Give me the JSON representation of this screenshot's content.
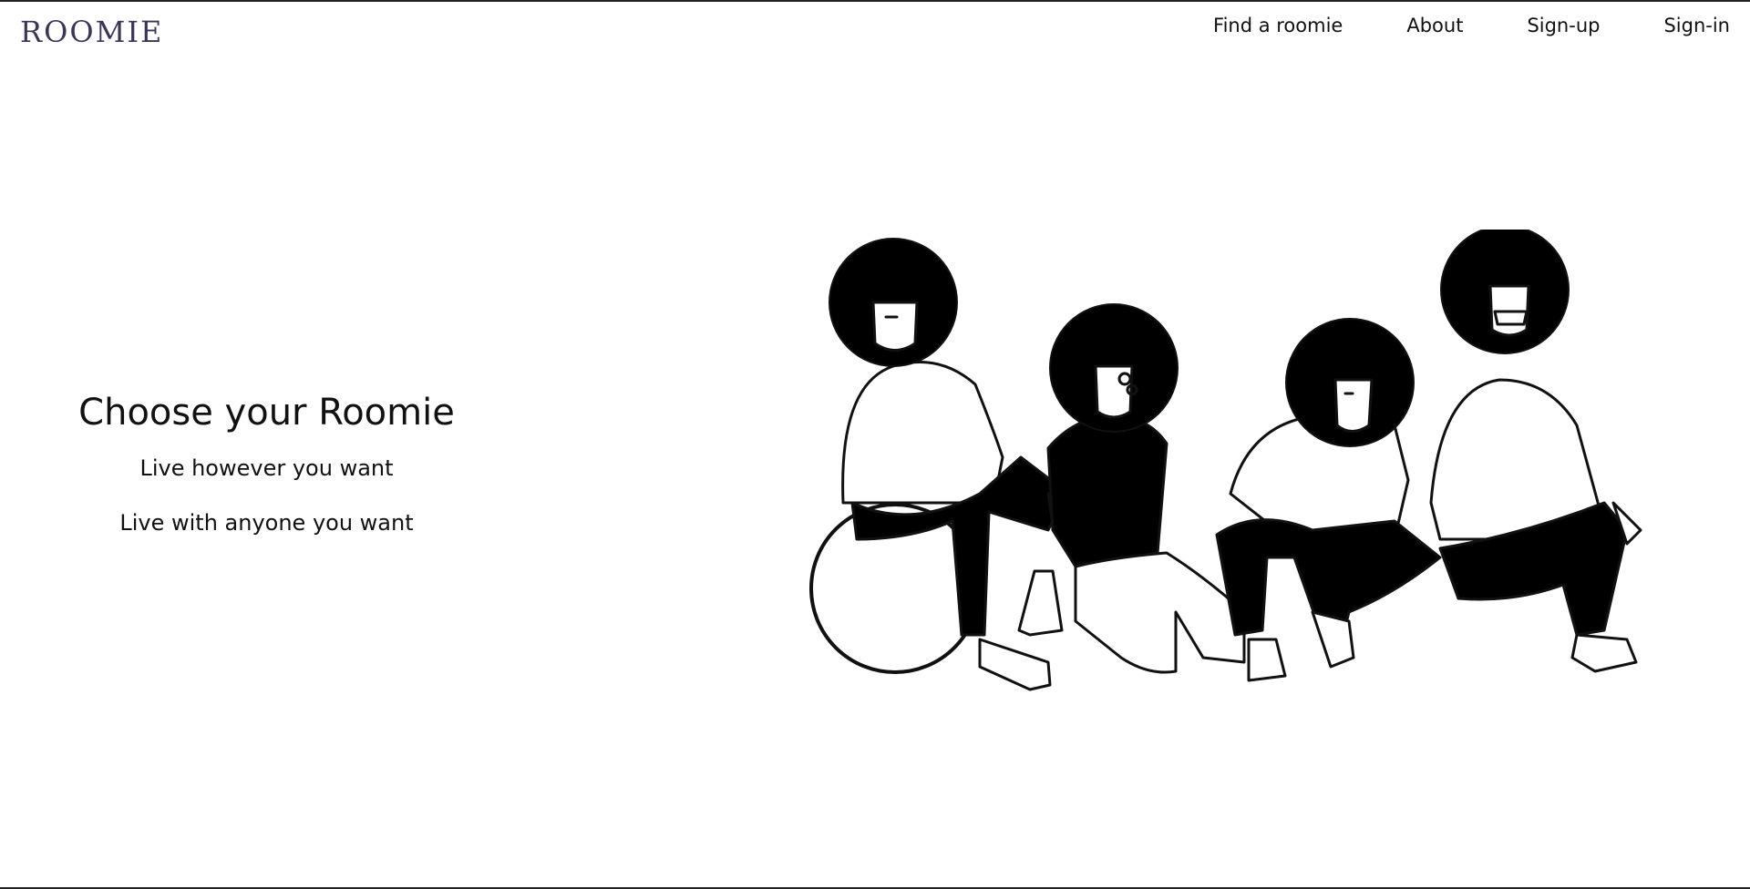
{
  "header": {
    "logo": "ROOMIE",
    "nav": [
      "Find a roomie",
      "About",
      "Sign-up",
      "Sign-in"
    ]
  },
  "hero": {
    "title": "Choose your Roomie",
    "subtitle1": "Live however you want",
    "subtitle2": "Live with anyone you want"
  }
}
